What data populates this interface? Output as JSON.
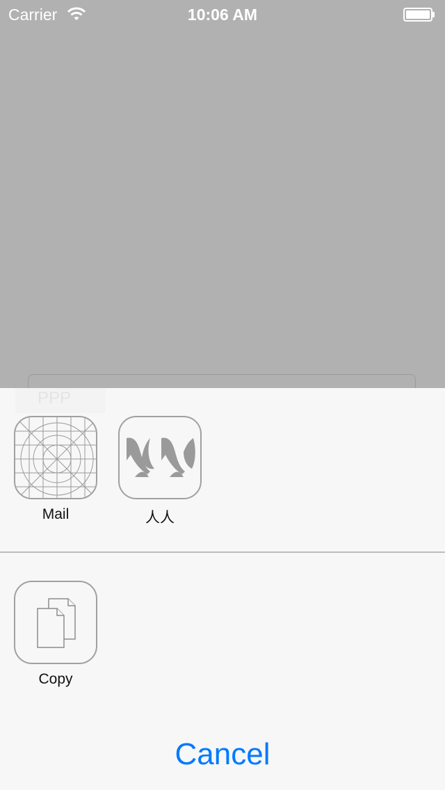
{
  "status_bar": {
    "carrier": "Carrier",
    "time": "10:06 AM",
    "wifi_icon": "wifi-icon",
    "battery_icon": "battery-icon"
  },
  "background": {
    "textfield_text": "PPP"
  },
  "share_sheet": {
    "share_targets": [
      {
        "label": "Mail",
        "icon": "mail-placeholder-icon"
      },
      {
        "label": "人人",
        "icon": "renren-icon"
      }
    ],
    "actions": [
      {
        "label": "Copy",
        "icon": "copy-icon"
      }
    ],
    "cancel_label": "Cancel"
  },
  "colors": {
    "accent": "#007aff",
    "dim_overlay": "#b1b1b1",
    "sheet_bg": "#f7f7f7"
  }
}
